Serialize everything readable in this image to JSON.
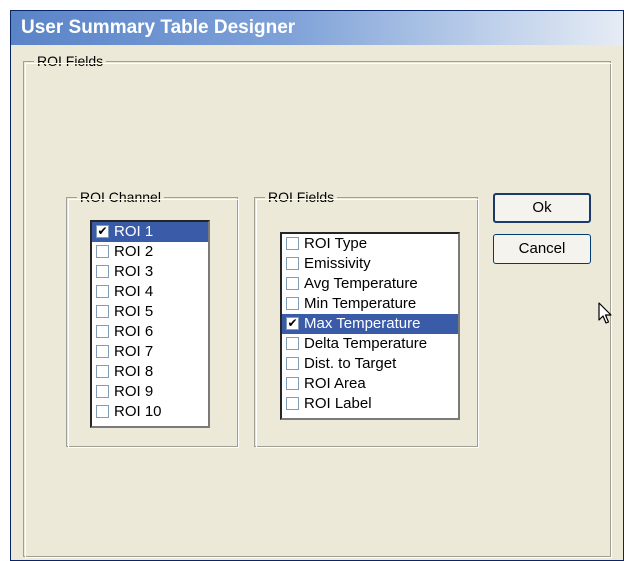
{
  "window": {
    "title": "User Summary Table Designer"
  },
  "outer_group": {
    "label": "ROI Fields"
  },
  "channel_group": {
    "label": "ROI Channel",
    "items": [
      {
        "label": "ROI 1",
        "checked": true,
        "selected": true
      },
      {
        "label": "ROI 2",
        "checked": false,
        "selected": false
      },
      {
        "label": "ROI 3",
        "checked": false,
        "selected": false
      },
      {
        "label": "ROI 4",
        "checked": false,
        "selected": false
      },
      {
        "label": "ROI 5",
        "checked": false,
        "selected": false
      },
      {
        "label": "ROI 6",
        "checked": false,
        "selected": false
      },
      {
        "label": "ROI 7",
        "checked": false,
        "selected": false
      },
      {
        "label": "ROI 8",
        "checked": false,
        "selected": false
      },
      {
        "label": "ROI 9",
        "checked": false,
        "selected": false
      },
      {
        "label": "ROI 10",
        "checked": false,
        "selected": false
      }
    ]
  },
  "fields_group": {
    "label": "ROI Fields",
    "items": [
      {
        "label": "ROI Type",
        "checked": false,
        "selected": false
      },
      {
        "label": "Emissivity",
        "checked": false,
        "selected": false
      },
      {
        "label": "Avg Temperature",
        "checked": false,
        "selected": false
      },
      {
        "label": "Min Temperature",
        "checked": false,
        "selected": false
      },
      {
        "label": "Max Temperature",
        "checked": true,
        "selected": true
      },
      {
        "label": "Delta Temperature",
        "checked": false,
        "selected": false
      },
      {
        "label": "Dist. to Target",
        "checked": false,
        "selected": false
      },
      {
        "label": "ROI Area",
        "checked": false,
        "selected": false
      },
      {
        "label": "ROI Label",
        "checked": false,
        "selected": false
      }
    ]
  },
  "buttons": {
    "ok_label": "Ok",
    "cancel_label": "Cancel"
  },
  "colors": {
    "selection": "#3a5ba8",
    "title_gradient_start": "#5a84c8",
    "dialog_bg": "#ece9d8"
  },
  "icons": {
    "check": "✔",
    "cursor": "arrow-cursor-icon"
  }
}
